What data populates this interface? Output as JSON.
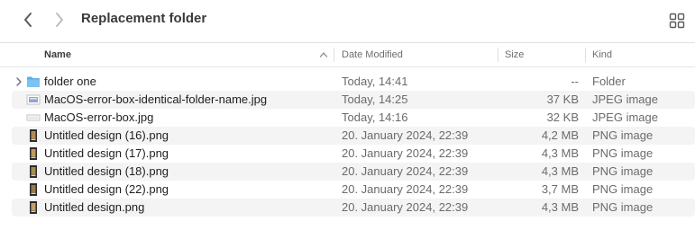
{
  "window": {
    "title": "Replacement folder"
  },
  "toolbar": {
    "back_icon": "chevron-left-icon",
    "forward_icon": "chevron-right-icon",
    "view_icon": "grid-view-icon"
  },
  "columns": {
    "name": "Name",
    "date": "Date Modified",
    "size": "Size",
    "kind": "Kind",
    "sort": "ascending by name"
  },
  "files": [
    {
      "name": "folder one",
      "date": "Today, 14:41",
      "size": "--",
      "kind": "Folder",
      "icon": "folder-icon"
    },
    {
      "name": "MacOS-error-box-identical-folder-name.jpg",
      "date": "Today, 14:25",
      "size": "37 KB",
      "kind": "JPEG image",
      "icon": "jpeg-file-icon"
    },
    {
      "name": "MacOS-error-box.jpg",
      "date": "Today, 14:16",
      "size": "32 KB",
      "kind": "JPEG image",
      "icon": "jpeg-file-icon"
    },
    {
      "name": "Untitled design (16).png",
      "date": "20. January 2024, 22:39",
      "size": "4,2 MB",
      "kind": "PNG image",
      "icon": "png-file-icon"
    },
    {
      "name": "Untitled design (17).png",
      "date": "20. January 2024, 22:39",
      "size": "4,3 MB",
      "kind": "PNG image",
      "icon": "png-file-icon"
    },
    {
      "name": "Untitled design (18).png",
      "date": "20. January 2024, 22:39",
      "size": "4,3 MB",
      "kind": "PNG image",
      "icon": "png-file-icon"
    },
    {
      "name": "Untitled design (22).png",
      "date": "20. January 2024, 22:39",
      "size": "3,7 MB",
      "kind": "PNG image",
      "icon": "png-file-icon"
    },
    {
      "name": "Untitled design.png",
      "date": "20. January 2024, 22:39",
      "size": "4,3 MB",
      "kind": "PNG image",
      "icon": "png-file-icon"
    }
  ],
  "colors": {
    "folder": "#5aaee8",
    "stripe": "#f4f4f4",
    "text": "#1e1e1e",
    "secondary_text": "#6b6b6b"
  }
}
